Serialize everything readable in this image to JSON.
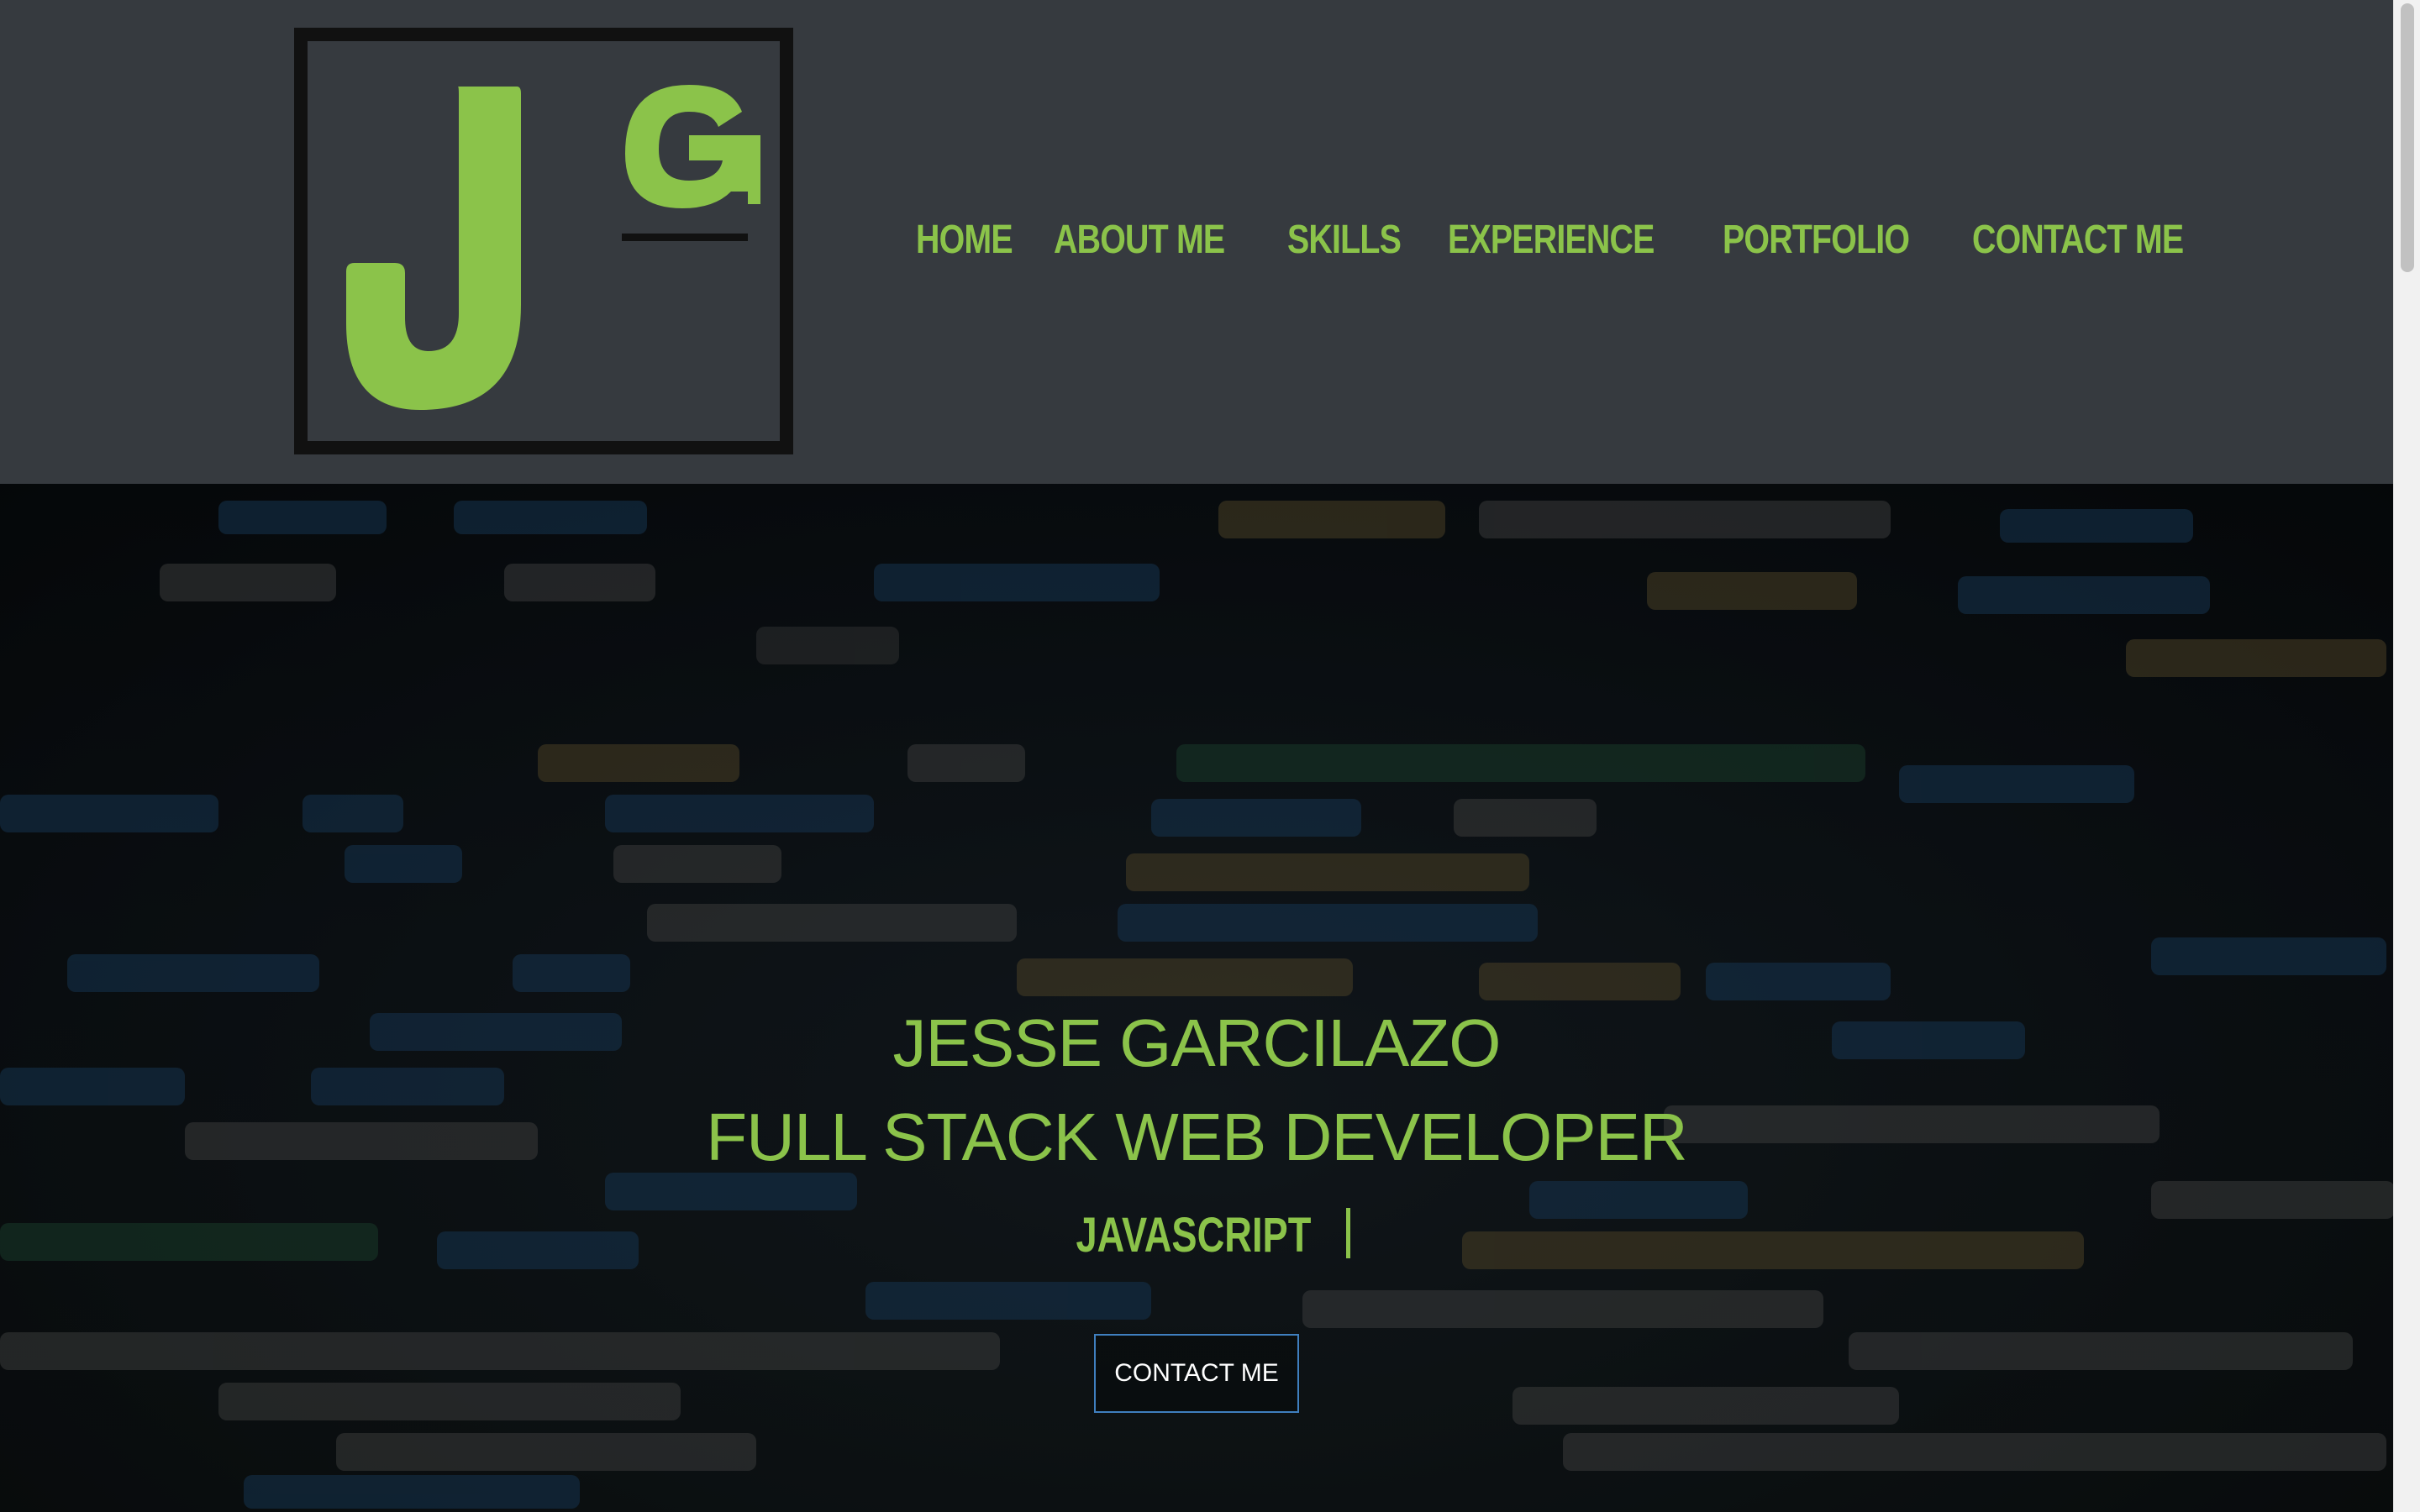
{
  "brand": {
    "logo_letters": "JG",
    "colors": {
      "accent": "#8bc34a",
      "header_bg": "#363a3f",
      "logo_frame": "#111111",
      "button_border": "#3f7fbf"
    }
  },
  "nav": {
    "items": [
      "HOME",
      "ABOUT ME",
      "SKILLS",
      "EXPERIENCE",
      "PORTFOLIO",
      "CONTACT ME"
    ]
  },
  "hero": {
    "name": "JESSE GARCILAZO",
    "title": "FULL STACK WEB DEVELOPER",
    "typed_text": "JAVASCRIPT",
    "cta_label": "CONTACT ME"
  }
}
